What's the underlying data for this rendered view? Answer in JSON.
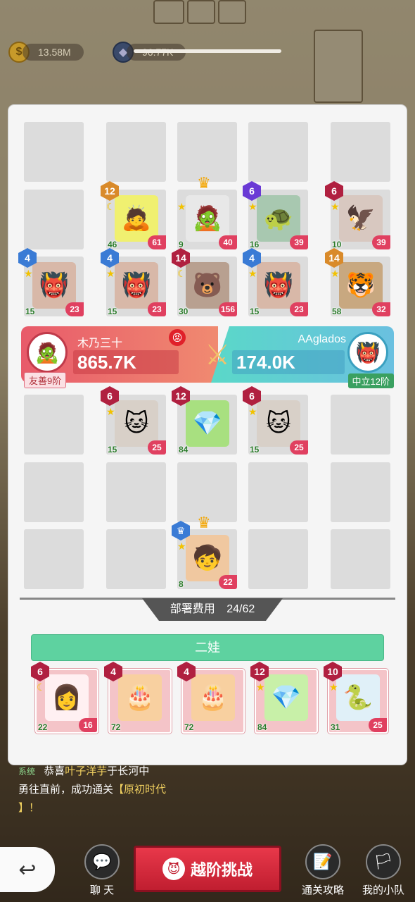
{
  "resources": {
    "gold": "13.58M",
    "gem": "96.77K"
  },
  "player": {
    "name": "木乃三十",
    "power": "865.7K",
    "tag": "友善9阶"
  },
  "opponent": {
    "name": "AAglados",
    "power": "174.0K",
    "tag": "中立12阶"
  },
  "enemy_units": [
    {
      "level": "12",
      "badge": "orange",
      "atk": "46",
      "hp": "61",
      "icon": "moon",
      "emoji": "🙇"
    },
    {
      "level": "",
      "badge": "",
      "atk": "9",
      "hp": "40",
      "icon": "star",
      "emoji": "🧟",
      "crown": true
    },
    {
      "level": "6",
      "badge": "purple",
      "atk": "16",
      "hp": "39",
      "icon": "star",
      "emoji": "🐢"
    },
    {
      "level": "6",
      "badge": "red",
      "atk": "10",
      "hp": "39",
      "icon": "star",
      "emoji": "🦅"
    },
    {
      "level": "4",
      "badge": "blue",
      "atk": "15",
      "hp": "23",
      "icon": "star",
      "emoji": "👹"
    },
    {
      "level": "4",
      "badge": "blue",
      "atk": "15",
      "hp": "23",
      "icon": "star",
      "emoji": "👹"
    },
    {
      "level": "14",
      "badge": "red",
      "atk": "30",
      "hp": "156",
      "icon": "moon",
      "emoji": "🐻"
    },
    {
      "level": "4",
      "badge": "blue",
      "atk": "15",
      "hp": "23",
      "icon": "star",
      "emoji": "👹"
    },
    {
      "level": "14",
      "badge": "orange",
      "atk": "58",
      "hp": "32",
      "icon": "star",
      "emoji": "🐯"
    }
  ],
  "player_units": [
    {
      "level": "6",
      "badge": "red",
      "atk": "15",
      "hp": "25",
      "icon": "star",
      "emoji": "🐱"
    },
    {
      "level": "12",
      "badge": "red",
      "atk": "84",
      "hp": "",
      "icon": "",
      "emoji": "💎"
    },
    {
      "level": "6",
      "badge": "red",
      "atk": "15",
      "hp": "25",
      "icon": "star",
      "emoji": "🐱"
    },
    {
      "level": "",
      "badge": "blue",
      "atk": "8",
      "hp": "22",
      "icon": "star",
      "emoji": "🧒",
      "crown": true
    }
  ],
  "deploy": {
    "label": "部署费用",
    "value": "24/62"
  },
  "selected_unit": "二娃",
  "cards": [
    {
      "level": "6",
      "atk": "22",
      "hp": "16",
      "emoji": "👩"
    },
    {
      "level": "4",
      "atk": "72",
      "hp": "",
      "emoji": "🎂"
    },
    {
      "level": "4",
      "atk": "72",
      "hp": "",
      "emoji": "🎂"
    },
    {
      "level": "12",
      "atk": "84",
      "hp": "",
      "emoji": "💎"
    },
    {
      "level": "10",
      "atk": "31",
      "hp": "25",
      "emoji": "🐍"
    }
  ],
  "chat": {
    "sys_tag": "系统",
    "line1_a": "恭喜",
    "line1_name": "叶子洋芋",
    "line1_b": "于长河中",
    "line2_a": "勇往直前，成功通关",
    "line2_b": "【原初时代",
    "line3": "】！"
  },
  "nav": {
    "chat": "聊 天",
    "challenge": "越阶挑战",
    "guide": "通关攻略",
    "team": "我的小队"
  },
  "colors": {
    "accent_red": "#c01e30",
    "accent_green": "#5ed2a0"
  }
}
